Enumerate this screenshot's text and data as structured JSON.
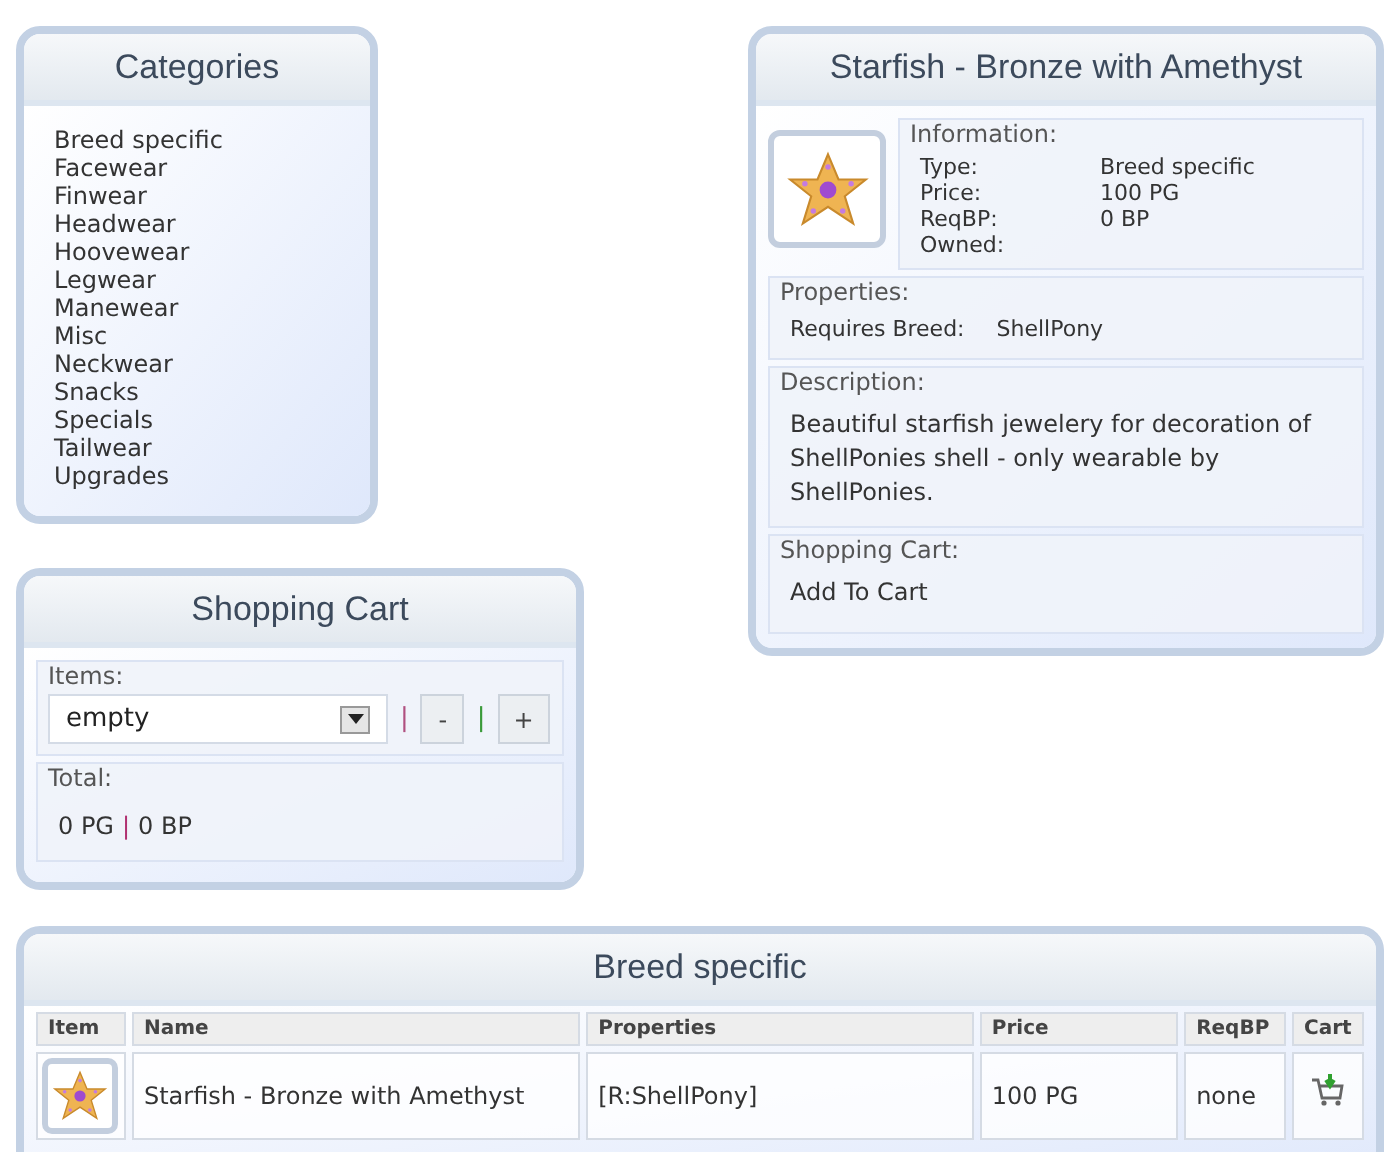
{
  "categories": {
    "title": "Categories",
    "items": [
      "Breed specific",
      "Facewear",
      "Finwear",
      "Headwear",
      "Hoovewear",
      "Legwear",
      "Manewear",
      "Misc",
      "Neckwear",
      "Snacks",
      "Specials",
      "Tailwear",
      "Upgrades"
    ]
  },
  "cart": {
    "title": "Shopping Cart",
    "items_label": "Items:",
    "select_value": "empty",
    "pipes": [
      "|",
      "|"
    ],
    "minus": "-",
    "plus": "+",
    "total_label": "Total:",
    "total_pg": "0 PG",
    "total_sep": "|",
    "total_bp": "0 BP"
  },
  "item": {
    "title": "Starfish - Bronze with Amethyst",
    "information": {
      "label": "Information:",
      "rows": [
        {
          "label": "Type:",
          "value": "Breed specific"
        },
        {
          "label": "Price:",
          "value": "100 PG"
        },
        {
          "label": "ReqBP:",
          "value": "0 BP"
        },
        {
          "label": "Owned:"
        }
      ]
    },
    "properties": {
      "label": "Properties:",
      "rows": [
        {
          "label": "Requires Breed:",
          "value": "ShellPony"
        }
      ]
    },
    "description": {
      "label": "Description:",
      "text": "Beautiful starfish jewelery for decoration of ShellPonies shell - only wearable by ShellPonies."
    },
    "cart": {
      "label": "Shopping Cart:",
      "action": "Add To Cart"
    }
  },
  "list": {
    "title": "Breed specific",
    "columns": [
      "Item",
      "Name",
      "Properties",
      "Price",
      "ReqBP",
      "Cart"
    ],
    "rows": [
      {
        "name": "Starfish - Bronze with Amethyst",
        "properties": "[R:ShellPony]",
        "price": "100 PG",
        "reqbp": "none"
      }
    ]
  }
}
